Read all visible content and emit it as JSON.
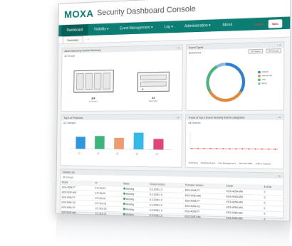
{
  "header": {
    "logo": "MOXA",
    "title": "Security Dashboard Console"
  },
  "nav": {
    "items": [
      {
        "label": "Dashboard",
        "active": true
      },
      {
        "label": "Visibility ▾"
      },
      {
        "label": "Event Management ▾"
      },
      {
        "label": "Log ▾"
      },
      {
        "label": "Administration ▾"
      },
      {
        "label": "About"
      }
    ],
    "user": "admin",
    "brand_badge": "SDC"
  },
  "tabs": {
    "summary": "Summary",
    "add": "+"
  },
  "panels": {
    "devices": {
      "title": "Asset Discovery Device Summary",
      "sub": "All Groups",
      "left_count": "3/4",
      "left_label": "Summary",
      "right_count": "13",
      "right_label": "Summary"
    },
    "donut": {
      "title": "Event Types",
      "sub": "All Devices",
      "btn1": "All Status",
      "btn2": "All Groups",
      "legend": [
        "Attack",
        "Abnormal",
        "Info",
        "Error"
      ],
      "colors": [
        "#2f7fd0",
        "#e08a3e",
        "#4cb27c",
        "#8bb8e0"
      ]
    },
    "bars": {
      "title": "Top 5 of Protocols",
      "sub": "All Changes",
      "categories": [
        "C1",
        "C2",
        "C3",
        "C4",
        "C5"
      ],
      "values": [
        14,
        15,
        13,
        19,
        12
      ],
      "colors": [
        "#2f96e0",
        "#3bb57a",
        "#f09a72",
        "#35b9e8",
        "#e0447a"
      ]
    },
    "line": {
      "title": "Trend of Top 5 Event Severity Event Categories",
      "sub": "All Devices",
      "legend": [
        "Scanning",
        "Hacking Event",
        "Info Management",
        "Internal traffic",
        "Infiltr.+Crypted"
      ]
    },
    "devlist": {
      "title": "Device List",
      "sub": "All Groups",
      "columns": [
        "Model",
        "IP",
        "Status",
        "Device Version",
        "Firmware Version",
        "Model",
        "Events"
      ],
      "rows": [
        [
          "EDS-405A-PT",
          "172.16.8.3",
          "Working",
          "6.0.2026.1.5",
          "EDS-405A-PT",
          "EDS-405A-MM",
          "0"
        ],
        [
          "EDS-510E-MM",
          "172.16.8.6",
          "Working",
          "6.0.2026.1.5",
          "EDS-510E-MM",
          "EDS-405A-MM",
          "0"
        ],
        [
          "EDS-405A-PT",
          "172.16.8.8",
          "Working",
          "6.0.2026.1.5",
          "EDS-405A-PT",
          "EDS-405A-MM",
          "0"
        ],
        [
          "EDS-408A-SS",
          "172.16.8.11",
          "Working",
          "6.0.2026.1.5",
          "EDS-408A-SS",
          "EDS-405A-MM",
          "0"
        ],
        [
          "EDS-405A-PT",
          "172.16.8.15",
          "Working",
          "6.0.2026.1.5",
          "EDS-405A-PT",
          "EDS-405A-MM",
          "0"
        ],
        [
          "EDS-510E-MM",
          "172.16.8.21",
          "Working",
          "6.0.2026.1.5",
          "EDS-510E-MM",
          "EDS-405A-MM",
          "0"
        ]
      ]
    }
  }
}
